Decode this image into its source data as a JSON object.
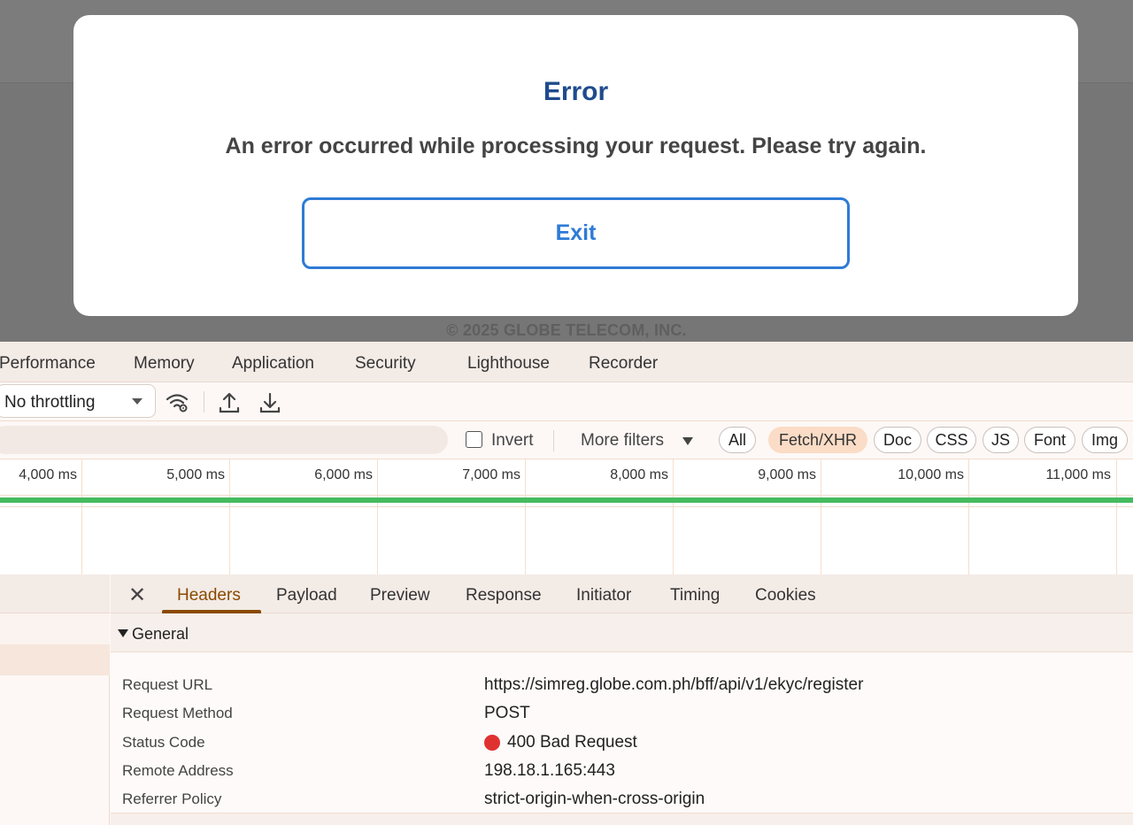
{
  "modal": {
    "title": "Error",
    "message": "An error occurred while processing your request. Please try again.",
    "exit_label": "Exit"
  },
  "page": {
    "footer": "© 2025 GLOBE TELECOM, INC."
  },
  "devtools": {
    "tabs": [
      "Performance",
      "Memory",
      "Application",
      "Security",
      "Lighthouse",
      "Recorder"
    ],
    "throttling": "No throttling",
    "filters": {
      "invert_label": "Invert",
      "more_filters_label": "More filters",
      "chips": [
        "All",
        "Fetch/XHR",
        "Doc",
        "CSS",
        "JS",
        "Font",
        "Img"
      ],
      "active_chip": "Fetch/XHR"
    },
    "timeline_ticks": [
      "4,000 ms",
      "5,000 ms",
      "6,000 ms",
      "7,000 ms",
      "8,000 ms",
      "9,000 ms",
      "10,000 ms",
      "11,000 ms"
    ],
    "detail_tabs": [
      "Headers",
      "Payload",
      "Preview",
      "Response",
      "Initiator",
      "Timing",
      "Cookies"
    ],
    "active_detail_tab": "Headers",
    "general": {
      "section_label": "General",
      "rows": [
        {
          "name": "Request URL",
          "value": "https://simreg.globe.com.ph/bff/api/v1/ekyc/register"
        },
        {
          "name": "Request Method",
          "value": "POST"
        },
        {
          "name": "Status Code",
          "value": "400 Bad Request"
        },
        {
          "name": "Remote Address",
          "value": "198.18.1.165:443"
        },
        {
          "name": "Referrer Policy",
          "value": "strict-origin-when-cross-origin"
        }
      ]
    }
  },
  "colors": {
    "modal_title": "#1f4b8e",
    "exit_button": "#2f7bd6",
    "active_chip": "#fbdcc6",
    "active_tab": "#8a4a00",
    "waterfall_bar": "#45bb5f",
    "status_error": "#e03131"
  },
  "icons": {
    "network_conditions": "wifi-gear-icon",
    "import": "upload-icon",
    "export": "download-icon",
    "close": "close-icon",
    "section_toggle": "triangle-down-icon",
    "checkbox": "checkbox-icon"
  }
}
